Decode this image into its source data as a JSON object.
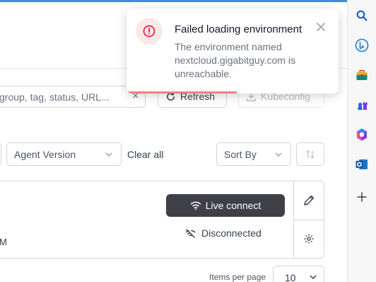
{
  "toolbar": {
    "search_placeholder": "group, tag, status, URL...",
    "clear_glyph": "×",
    "refresh_label": "Refresh",
    "kubeconfig_label": "Kubeconfig"
  },
  "filters": {
    "agent_version_label": "Agent Version",
    "clear_all_label": "Clear all",
    "sort_by_label": "Sort By"
  },
  "environment_card": {
    "partial_text": "M",
    "live_connect_label": "Live connect",
    "status_label": "Disconnected"
  },
  "pagination": {
    "items_per_page_label": "Items per page",
    "items_per_page_value": "10"
  },
  "toast": {
    "title": "Failed loading environment",
    "message": "The environment named nextcloud.gigabitguy.com is unreachable.",
    "progress_fraction": 0.52
  },
  "sidebar_icons": [
    "search-icon",
    "bing-icon",
    "briefcase-icon",
    "games-icon",
    "office-icon",
    "outlook-icon",
    "plus-icon"
  ],
  "colors": {
    "accent": "#3c8dde",
    "error": "#e11d48",
    "live_button_bg": "#3f3f46",
    "toast_progress": "#f08080"
  }
}
